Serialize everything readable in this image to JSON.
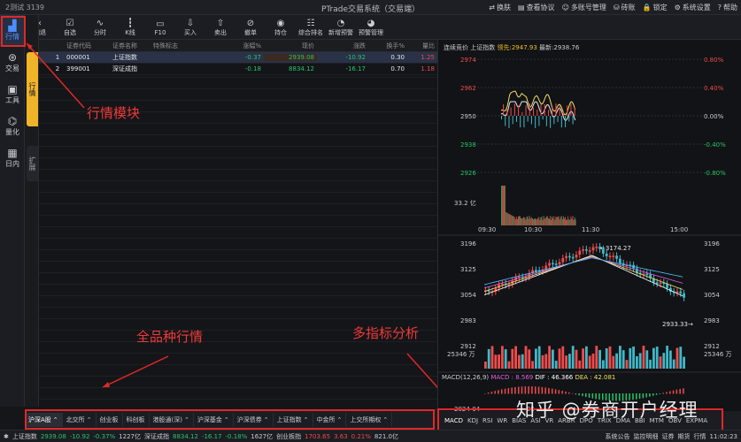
{
  "titlebar": {
    "left_text": "2测试 3139",
    "title": "PTrade交易系统（交易端）",
    "menu": [
      {
        "icon": "switch-icon",
        "label": "换肤"
      },
      {
        "icon": "doc-icon",
        "label": "查看协议"
      },
      {
        "icon": "user-icon",
        "label": "多账号管理"
      },
      {
        "icon": "lock-icon",
        "label": "砖账"
      },
      {
        "icon": "lock2-icon",
        "label": "锁定"
      },
      {
        "icon": "gear-icon",
        "label": "系统设置"
      },
      {
        "icon": "help-icon",
        "label": "帮助"
      }
    ]
  },
  "rail": [
    {
      "icon": "chart-icon",
      "label": "行情",
      "active": true
    },
    {
      "icon": "trade-icon",
      "label": "交易",
      "active": false
    },
    {
      "icon": "tool-icon",
      "label": "工具",
      "active": false
    },
    {
      "icon": "quant-icon",
      "label": "量化",
      "active": false
    },
    {
      "icon": "calendar-icon",
      "label": "日内",
      "active": false
    }
  ],
  "sidetabs": {
    "quote": "行情",
    "ext": "扩展"
  },
  "toolbar": [
    {
      "icon": "back-icon",
      "label": "回退"
    },
    {
      "icon": "watchlist-icon",
      "label": "自选"
    },
    {
      "icon": "intraday-icon",
      "label": "分时"
    },
    {
      "icon": "kline-icon",
      "label": "K线"
    },
    {
      "icon": "f10-icon",
      "label": "F10"
    },
    {
      "icon": "buy-icon",
      "label": "买入"
    },
    {
      "icon": "sell-icon",
      "label": "卖出"
    },
    {
      "icon": "cancel-icon",
      "label": "撤单"
    },
    {
      "icon": "position-icon",
      "label": "持仓"
    },
    {
      "icon": "account-icon",
      "label": "综合排名"
    },
    {
      "icon": "alert-icon",
      "label": "新增预警"
    },
    {
      "icon": "alert-manage-icon",
      "label": "预警管理"
    }
  ],
  "table": {
    "headers": [
      "",
      "",
      "证券代码",
      "证券名称",
      "特殊标志",
      "涨幅%",
      "现价",
      "涨跌",
      "换手%",
      "量比"
    ],
    "rows": [
      {
        "idx": "1",
        "code": "000001",
        "name": "上证指数",
        "flag": "",
        "pct": "-0.37",
        "price": "2939.08",
        "chg": "-10.92",
        "turnover": "0.30",
        "ratio": "1.25",
        "selected": true
      },
      {
        "idx": "2",
        "code": "399001",
        "name": "深证成指",
        "flag": "",
        "pct": "-0.18",
        "price": "8834.12",
        "chg": "-16.17",
        "turnover": "0.70",
        "ratio": "1.18",
        "selected": false
      }
    ]
  },
  "annotations": {
    "quote_module": "行情模块",
    "all_markets": "全品种行情",
    "multi_indicator": "多指标分析"
  },
  "categories": [
    {
      "label": "沪深A股",
      "active": true
    },
    {
      "label": "北交所"
    },
    {
      "label": "创业板"
    },
    {
      "label": "科创板"
    },
    {
      "label": "港股通(深)"
    },
    {
      "label": "沪深基金"
    },
    {
      "label": "沪深债券"
    },
    {
      "label": "上证指数"
    },
    {
      "label": "中金所"
    },
    {
      "label": "上交所期权"
    }
  ],
  "statusbar": {
    "items": [
      {
        "label": "上证指数",
        "value": "2939.08",
        "chg": "-10.92",
        "pct": "-0.37%",
        "vol": "1227亿"
      },
      {
        "label": "深证成指",
        "value": "8834.12",
        "chg": "-16.17",
        "pct": "-0.18%",
        "vol": "1627亿"
      },
      {
        "label": "创业板指",
        "value": "1703.65",
        "chg": "3.63",
        "pct": "0.21%",
        "vol": "821.0亿"
      }
    ],
    "right": [
      {
        "label": "系统公告"
      },
      {
        "label": "监控明细"
      },
      {
        "label": "证券"
      },
      {
        "label": "期货"
      },
      {
        "label": "行情"
      }
    ],
    "time": "11:02:23"
  },
  "chart": {
    "header": {
      "prefix": "连续竞价",
      "name": "上证指数",
      "lead_label": "领先",
      "lead_value": "2947.93",
      "latest_label": "最新",
      "latest_value": "2938.76"
    },
    "intraday": {
      "y_left": [
        "2974",
        "2962",
        "2950",
        "2938",
        "2926"
      ],
      "y_right": [
        "0.80%",
        "0.40%",
        "0.00%",
        "-0.40%",
        "-0.80%"
      ],
      "vol_label": "33.2 亿",
      "times": [
        "09:30",
        "10:30",
        "11:30",
        "15:00"
      ]
    },
    "kline": {
      "y_left": [
        "3196",
        "3125",
        "3054",
        "2983",
        "2912"
      ],
      "high_label": "←3174.27",
      "low_label": "2933.33→",
      "vol_label": "25346 万"
    },
    "macd": {
      "title": "MACD(12,26,9)",
      "macd_label": "MACD",
      "macd": "8.569",
      "dif_label": "DIF",
      "dif": "46.366",
      "dea_label": "DEA",
      "dea": "42.081",
      "date": "2024-04",
      "month": "05"
    },
    "indicators": [
      "MACD",
      "KDJ",
      "RSI",
      "WR",
      "BIAS",
      "ASI",
      "VR",
      "ARBR",
      "DPO",
      "TRIX",
      "DMA",
      "BBI",
      "MTM",
      "OBV",
      "EXPMA"
    ]
  },
  "watermark": "知乎 @券商开户经理",
  "colors": {
    "up": "#f04b4b",
    "down": "#27c46b",
    "accent": "#4d8dff",
    "annotation": "#f03a3a",
    "price_line": "#e8e8e8",
    "avg_line": "#f0e060"
  }
}
